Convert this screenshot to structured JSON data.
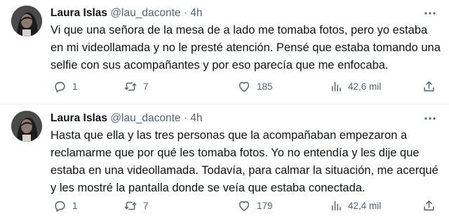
{
  "tweets": [
    {
      "name": "Laura Islas",
      "handle": "@lau_daconte",
      "separator": "·",
      "time": "4h",
      "text": "Vi que una señora de la mesa de a lado me tomaba fotos, pero yo estaba en mi videollamada y no le presté atención. Pensé que estaba tomando una selfie con sus acompañantes y por eso parecía que me enfocaba.",
      "replies": "1",
      "retweets": "7",
      "likes": "185",
      "views": "42,6 mil"
    },
    {
      "name": "Laura Islas",
      "handle": "@lau_daconte",
      "separator": "·",
      "time": "4h",
      "text": "Hasta que ella y las tres personas que la acompañaban empezaron a reclamarme que por qué les tomaba fotos. Yo no entendía y les dije que estaba en una videollamada. Todavía, para calmar la situación, me acerqué y les mostré la pantalla donde se veía que estaba conectada.",
      "replies": "1",
      "retweets": "7",
      "likes": "179",
      "views": "42,4 mil"
    }
  ],
  "icons": {
    "reply": "reply-icon",
    "retweet": "retweet-icon",
    "like": "heart-icon",
    "views": "views-icon",
    "share": "share-icon",
    "more": "more-icon"
  }
}
